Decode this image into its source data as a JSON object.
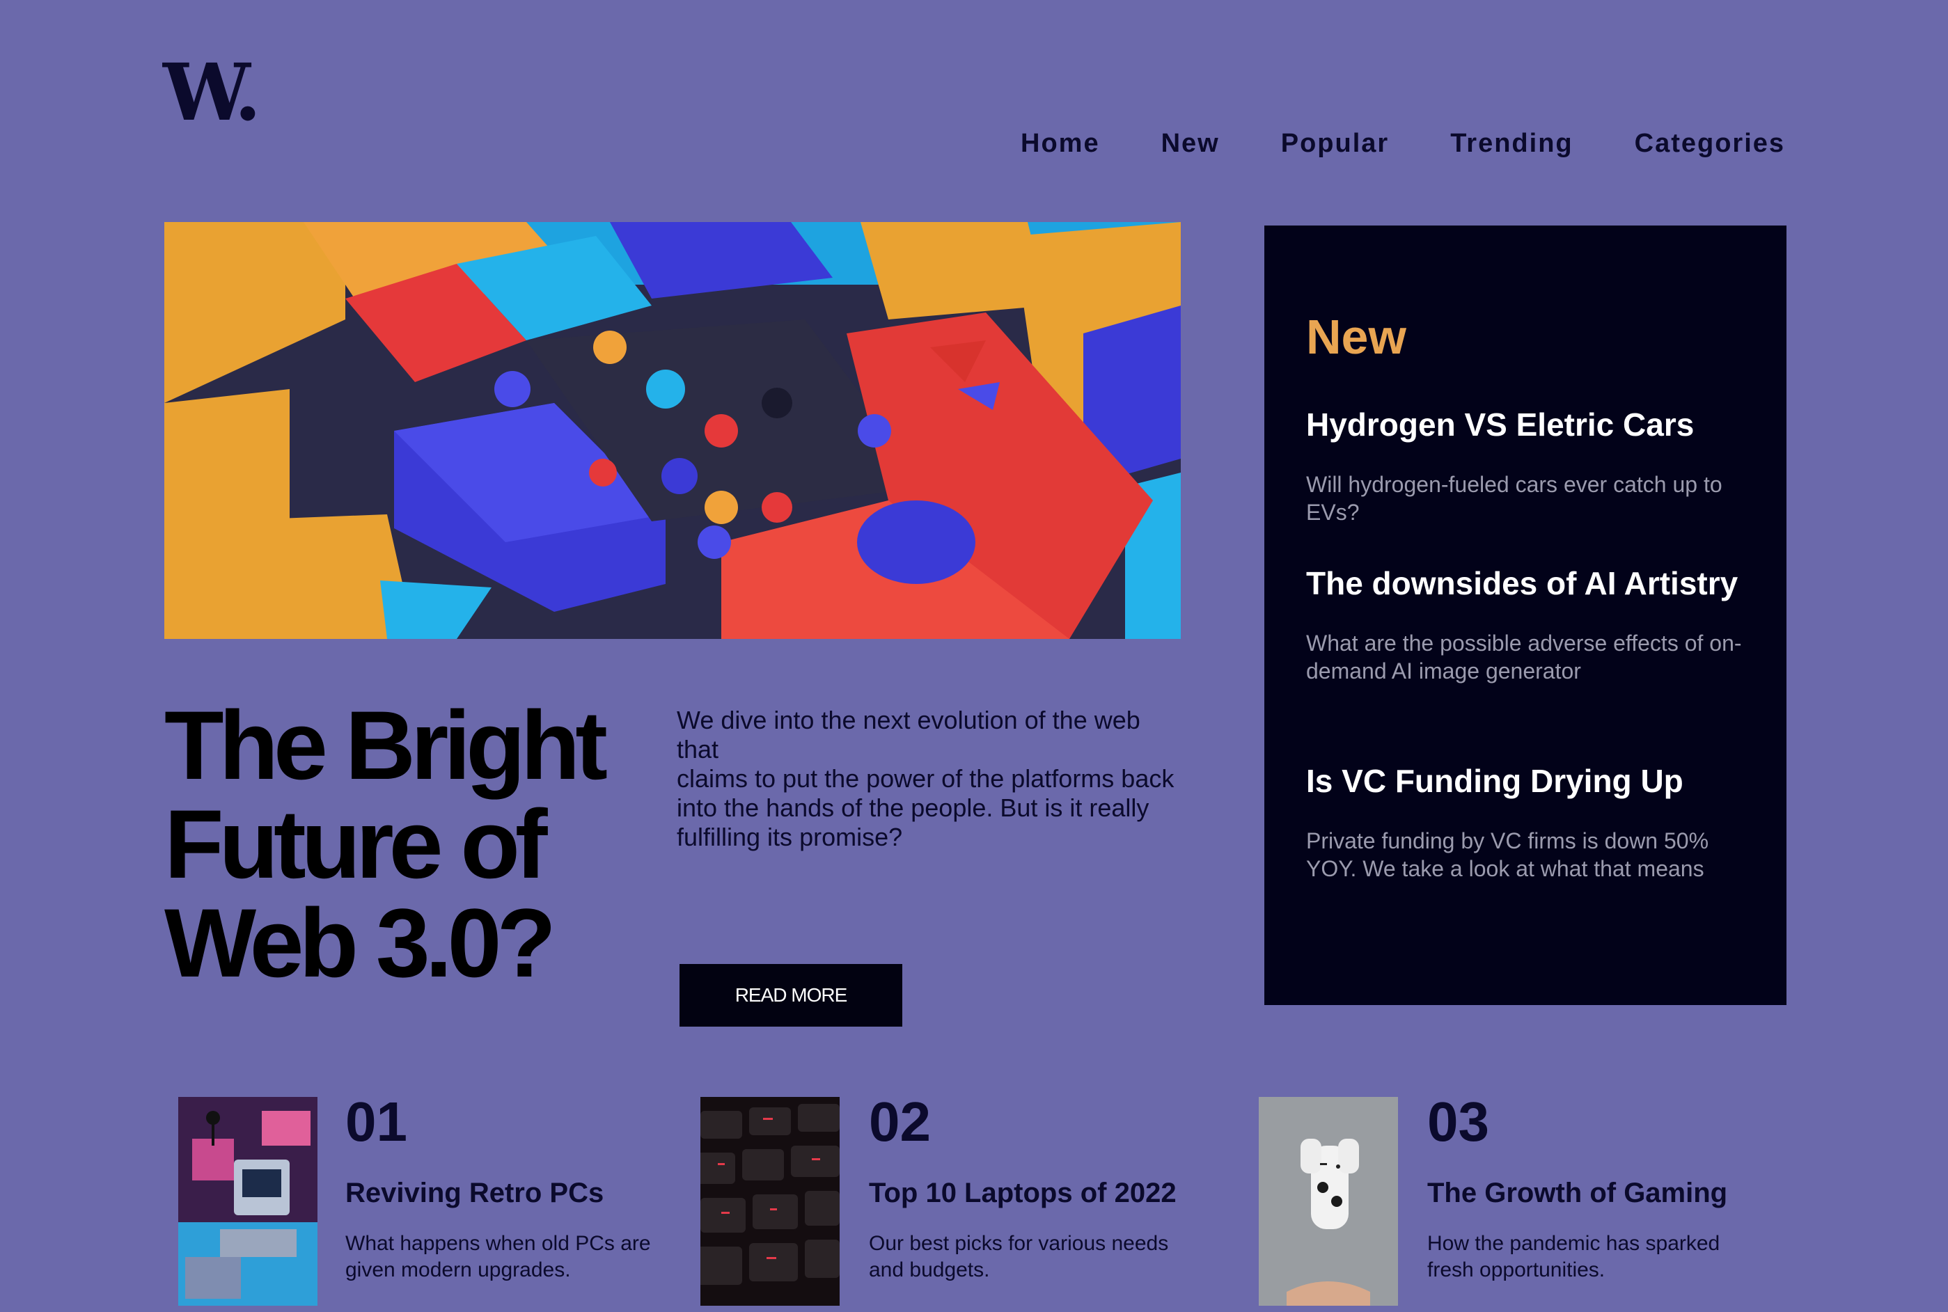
{
  "brand": {
    "logo": "W."
  },
  "nav": {
    "items": [
      "Home",
      "New",
      "Popular",
      "Trending",
      "Categories"
    ]
  },
  "hero": {
    "title": "The Bright Future of Web 3.0?",
    "intro": "We dive into the next evolution of the web that\nclaims to put the power of the platforms back\ninto the hands of the people. But is it really\nfulfilling its promise?",
    "button": "READ MORE",
    "image_icon": "abstract-3d-blocks-image"
  },
  "new_panel": {
    "title": "New",
    "items": [
      {
        "title": "Hydrogen VS Eletric Cars",
        "desc": "Will hydrogen-fueled cars ever catch up to EVs?"
      },
      {
        "title": "The downsides of AI Artistry",
        "desc": "What are the possible adverse effects of on-demand AI image generator"
      },
      {
        "title": "Is VC Funding Drying Up",
        "desc": "Private funding by VC firms is down 50% YOY. We take a look at what that means"
      }
    ]
  },
  "articles": [
    {
      "num": "01",
      "title": "Reviving Retro PCs",
      "desc": "What happens when old PCs are given modern upgrades.",
      "image_icon": "retro-pc-image"
    },
    {
      "num": "02",
      "title": "Top 10 Laptops of 2022",
      "desc": "Our best picks for various needs and budgets.",
      "image_icon": "keyboard-image"
    },
    {
      "num": "03",
      "title": "The Growth of Gaming",
      "desc": "How the pandemic has sparked fresh opportunities.",
      "image_icon": "gamepad-image"
    }
  ],
  "colors": {
    "background": "#6B69AB",
    "dark": "#020219",
    "accent": "#E9A552"
  }
}
